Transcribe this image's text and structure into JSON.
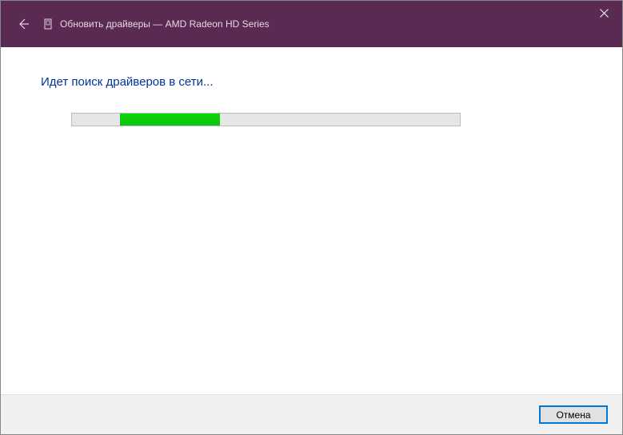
{
  "titlebar": {
    "title": "Обновить драйверы — AMD Radeon HD         Series"
  },
  "content": {
    "heading": "Идет поиск драйверов в сети..."
  },
  "footer": {
    "cancel_label": "Отмена"
  },
  "progress": {
    "indeterminate": true,
    "fill_offset_percent": 12,
    "fill_width_percent": 26
  },
  "colors": {
    "titlebar_bg": "#5a2a52",
    "heading_color": "#003399",
    "progress_fill": "#0dc40d",
    "button_focus": "#0078d7"
  }
}
